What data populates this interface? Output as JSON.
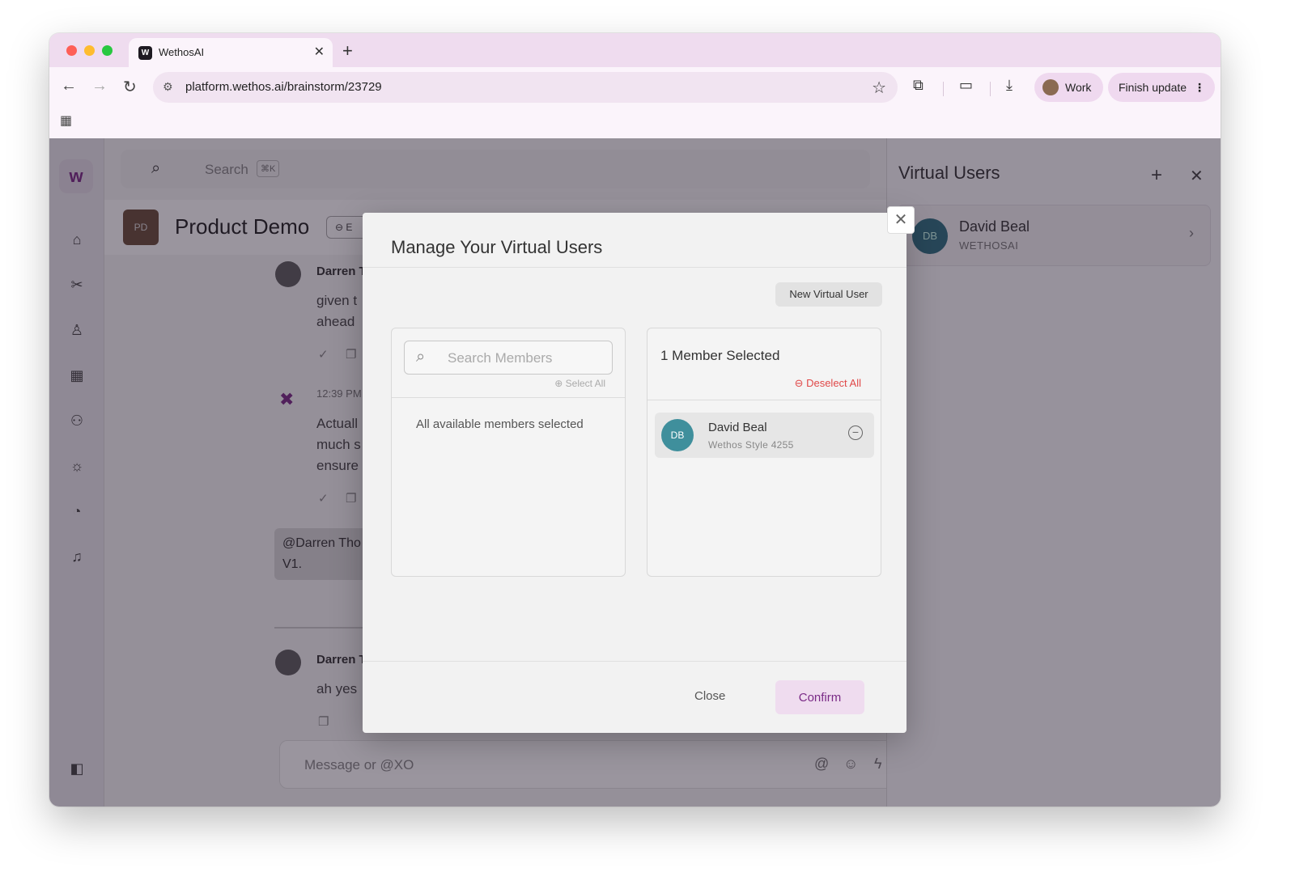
{
  "browser": {
    "tab_title": "WethosAI",
    "favicon_letter": "W",
    "tab_close": "✕",
    "new_tab": "+",
    "url": "platform.wethos.ai/brainstorm/23729",
    "profile_label": "Work",
    "update_label": "Finish update"
  },
  "sidebar_nav": {
    "logo": "w"
  },
  "main": {
    "search_placeholder": "Search",
    "search_shortcut": "⌘K",
    "page_badge": "PD",
    "page_title": "Product Demo",
    "edit_chip": "E",
    "messages": [
      {
        "author": "Darren T",
        "text1": "given t",
        "text2": "ahead"
      },
      {
        "time": "12:39 PM",
        "text1": "Actuall",
        "text2": "much s",
        "text3": "ensure"
      },
      {
        "bubble1": "@Darren Tho",
        "bubble2": "V1."
      },
      {
        "author": "Darren T",
        "text1": "ah yes"
      }
    ],
    "message_placeholder": "Message or @XO"
  },
  "right_panel": {
    "title": "Virtual Users",
    "card": {
      "initials": "DB",
      "name": "David Beal",
      "org": "WETHOSAI"
    }
  },
  "modal": {
    "title": "Manage Your Virtual Users",
    "new_button": "New Virtual User",
    "search_placeholder": "Search Members",
    "select_all": "Select All",
    "empty_message": "All available members selected",
    "selected_title": "1 Member Selected",
    "deselect_all": "Deselect All",
    "member": {
      "initials": "DB",
      "name": "David Beal",
      "style": "Wethos Style 4255"
    },
    "close_label": "Close",
    "confirm_label": "Confirm"
  }
}
